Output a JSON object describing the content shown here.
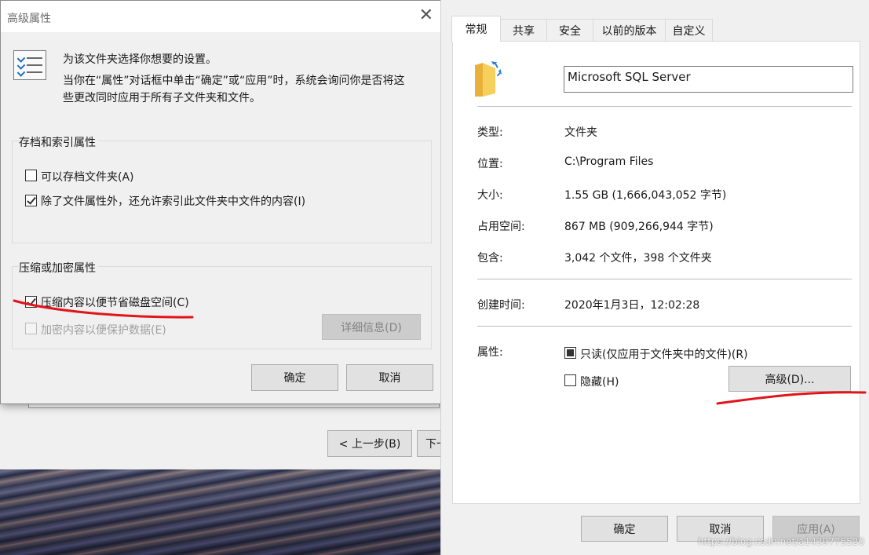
{
  "wizard": {
    "back_button": "< 上一步(B)",
    "next_button_partial": "下一"
  },
  "advanced": {
    "title": "高级属性",
    "close_glyph": "✕",
    "intro_line1": "为该文件夹选择你想要的设置。",
    "intro_line2": "当你在“属性”对话框中单击“确定”或“应用”时，系统会询问你是否将这",
    "intro_line3": "些更改同时应用于所有子文件夹和文件。",
    "archive_group": {
      "title": "存档和索引属性",
      "archive_label": "可以存档文件夹(A)",
      "archive_checked": false,
      "index_label": "除了文件属性外，还允许索引此文件夹中文件的内容(I)",
      "index_checked": true
    },
    "compress_group": {
      "title": "压缩或加密属性",
      "compress_label": "压缩内容以便节省磁盘空间(C)",
      "compress_checked": true,
      "encrypt_label": "加密内容以便保护数据(E)",
      "encrypt_checked": false,
      "details_button": "详细信息(D)"
    },
    "ok_button": "确定",
    "cancel_button": "取消"
  },
  "properties": {
    "tabs": [
      {
        "label": "常规"
      },
      {
        "label": "共享"
      },
      {
        "label": "安全"
      },
      {
        "label": "以前的版本"
      },
      {
        "label": "自定义"
      }
    ],
    "folder_name": "Microsoft SQL Server",
    "rows": [
      {
        "label": "类型:",
        "value": "文件夹"
      },
      {
        "label": "位置:",
        "value": "C:\\Program Files"
      },
      {
        "label": "大小:",
        "value": "1.55 GB (1,666,043,052 字节)"
      },
      {
        "label": "占用空间:",
        "value": "867 MB (909,266,944 字节)"
      },
      {
        "label": "包含:",
        "value": "3,042 个文件，398 个文件夹"
      }
    ],
    "created_label": "创建时间:",
    "created_value": "2020年1月3日，12:02:28",
    "attributes_label": "属性:",
    "readonly_label": "只读(仅应用于文件夹中的文件)(R)",
    "hidden_label": "隐藏(H)",
    "advanced_button": "高级(D)...",
    "ok_button": "确定",
    "cancel_button": "取消",
    "apply_button": "应用(A)"
  },
  "watermark": "https://blog.csdn.net/a1439775520",
  "colors": {
    "annotation_red": "#e0151c",
    "focus_blue": "#0078d7",
    "folder_yellow": "#f5c542"
  }
}
